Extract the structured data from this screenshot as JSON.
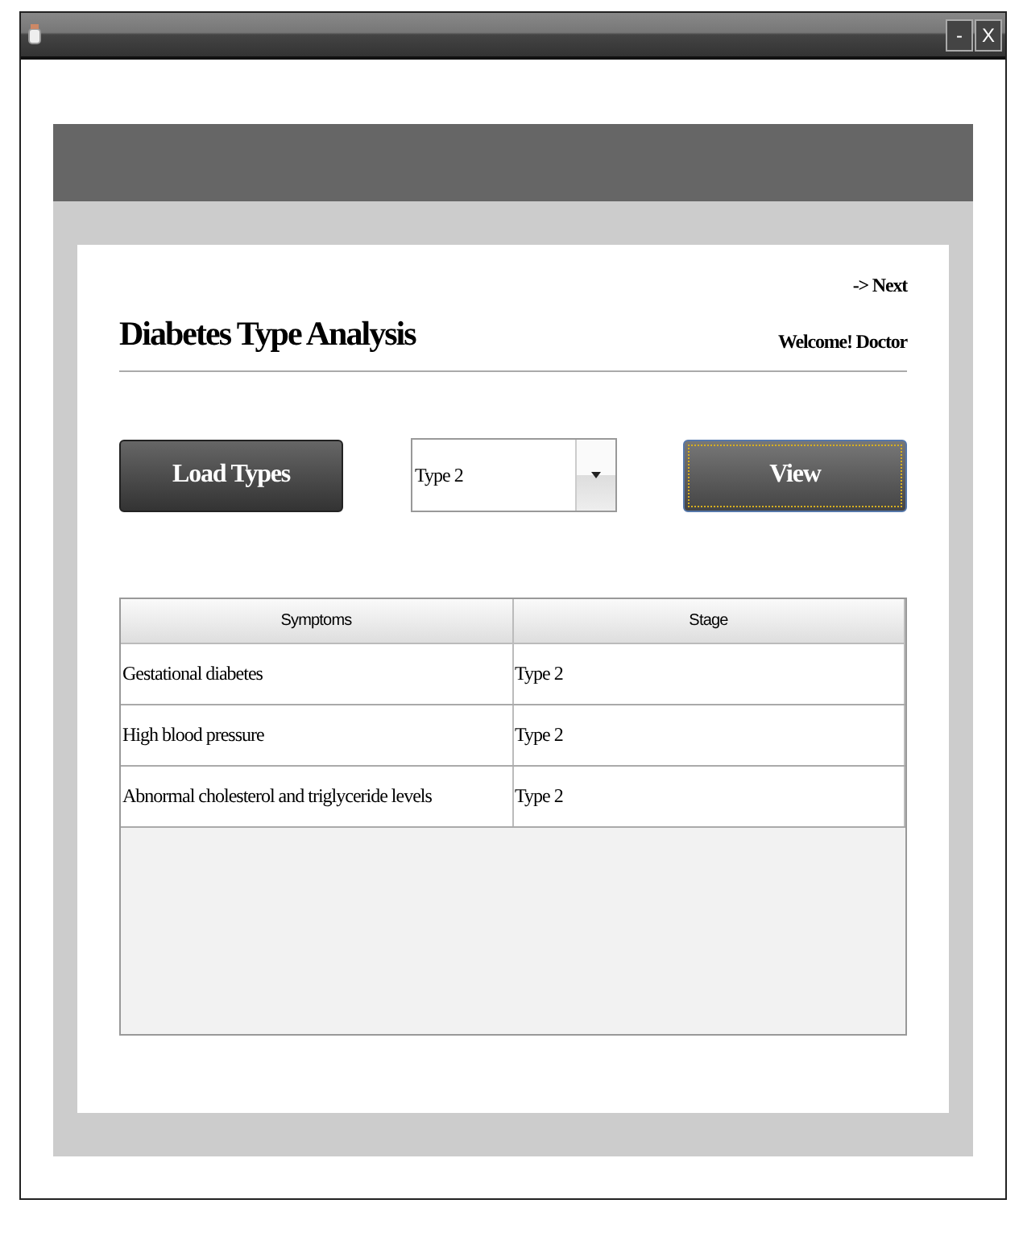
{
  "window": {
    "controls": [
      "-",
      "X"
    ]
  },
  "header": {
    "next_link": "-> Next",
    "title": "Diabetes Type Analysis",
    "welcome": "Welcome! Doctor"
  },
  "toolbar": {
    "load_button": "Load Types",
    "type_select": {
      "value": "Type 2"
    },
    "view_button": "View"
  },
  "table": {
    "columns": [
      "Symptoms",
      "Stage"
    ],
    "rows": [
      [
        "Gestational diabetes",
        "Type 2"
      ],
      [
        "High blood pressure",
        "Type 2"
      ],
      [
        "Abnormal cholesterol and triglyceride levels",
        "Type 2"
      ]
    ]
  }
}
